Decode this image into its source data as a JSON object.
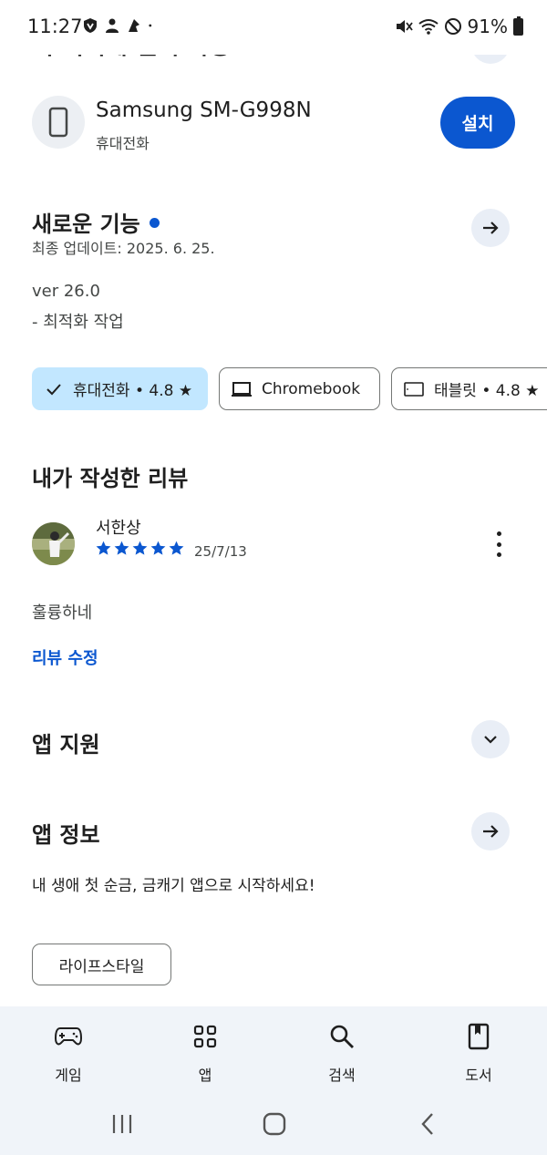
{
  "status_bar": {
    "time": "11:27",
    "battery": "91%"
  },
  "header": {
    "clipped_title": "이 기기에 설치 가능"
  },
  "device": {
    "name": "Samsung SM-G998N",
    "type": "휴대전화",
    "install_label": "설치"
  },
  "whats_new": {
    "title": "새로운 기능",
    "updated": "최종 업데이트: 2025. 6. 25.",
    "version": "ver 26.0",
    "note": "- 최적화 작업"
  },
  "chips": [
    {
      "label": "휴대전화 • 4.8 ★",
      "selected": true
    },
    {
      "label": "Chromebook",
      "selected": false
    },
    {
      "label": "태블릿 • 4.8 ★",
      "selected": false
    }
  ],
  "my_review": {
    "title": "내가 작성한 리뷰",
    "reviewer": "서한상",
    "rating": 5,
    "date": "25/7/13",
    "text": "훌륭하네",
    "edit_label": "리뷰 수정"
  },
  "app_support": {
    "title": "앱 지원"
  },
  "app_info": {
    "title": "앱 정보",
    "description": "내 생애 첫 순금, 금캐기 앱으로 시작하세요!",
    "tag": "라이프스타일"
  },
  "bottom_nav": {
    "items": [
      {
        "label": "게임",
        "icon": "gamepad-icon"
      },
      {
        "label": "앱",
        "icon": "apps-grid-icon"
      },
      {
        "label": "검색",
        "icon": "search-icon"
      },
      {
        "label": "도서",
        "icon": "book-icon"
      }
    ]
  },
  "colors": {
    "accent": "#0b57d0",
    "chip_selected": "#c2e7ff",
    "nav_bg": "#f0f4f9"
  }
}
